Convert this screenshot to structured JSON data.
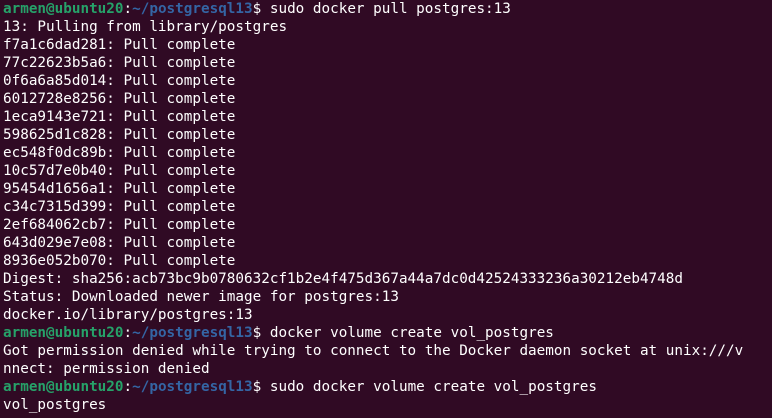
{
  "colors": {
    "background": "#300a24",
    "text": "#ffffff",
    "prompt_user": "#26a269",
    "prompt_path": "#3465a4"
  },
  "prompt": {
    "user_host": "armen@ubuntu20",
    "separator": ":",
    "path": "~/postgresql13",
    "symbol": "$ "
  },
  "lines": [
    {
      "type": "prompt",
      "command": "sudo docker pull postgres:13"
    },
    {
      "type": "output",
      "text": "13: Pulling from library/postgres"
    },
    {
      "type": "output",
      "text": "f7a1c6dad281: Pull complete"
    },
    {
      "type": "output",
      "text": "77c22623b5a6: Pull complete"
    },
    {
      "type": "output",
      "text": "0f6a6a85d014: Pull complete"
    },
    {
      "type": "output",
      "text": "6012728e8256: Pull complete"
    },
    {
      "type": "output",
      "text": "1eca9143e721: Pull complete"
    },
    {
      "type": "output",
      "text": "598625d1c828: Pull complete"
    },
    {
      "type": "output",
      "text": "ec548f0dc89b: Pull complete"
    },
    {
      "type": "output",
      "text": "10c57d7e0b40: Pull complete"
    },
    {
      "type": "output",
      "text": "95454d1656a1: Pull complete"
    },
    {
      "type": "output",
      "text": "c34c7315d399: Pull complete"
    },
    {
      "type": "output",
      "text": "2ef684062cb7: Pull complete"
    },
    {
      "type": "output",
      "text": "643d029e7e08: Pull complete"
    },
    {
      "type": "output",
      "text": "8936e052b070: Pull complete"
    },
    {
      "type": "output",
      "text": "Digest: sha256:acb73bc9b0780632cf1b2e4f475d367a44a7dc0d42524333236a30212eb4748d"
    },
    {
      "type": "output",
      "text": "Status: Downloaded newer image for postgres:13"
    },
    {
      "type": "output",
      "text": "docker.io/library/postgres:13"
    },
    {
      "type": "prompt",
      "command": "docker volume create vol_postgres"
    },
    {
      "type": "output",
      "text": "Got permission denied while trying to connect to the Docker daemon socket at unix:///v"
    },
    {
      "type": "output",
      "text": "nnect: permission denied"
    },
    {
      "type": "prompt",
      "command": "sudo docker volume create vol_postgres"
    },
    {
      "type": "output",
      "text": "vol_postgres"
    }
  ]
}
